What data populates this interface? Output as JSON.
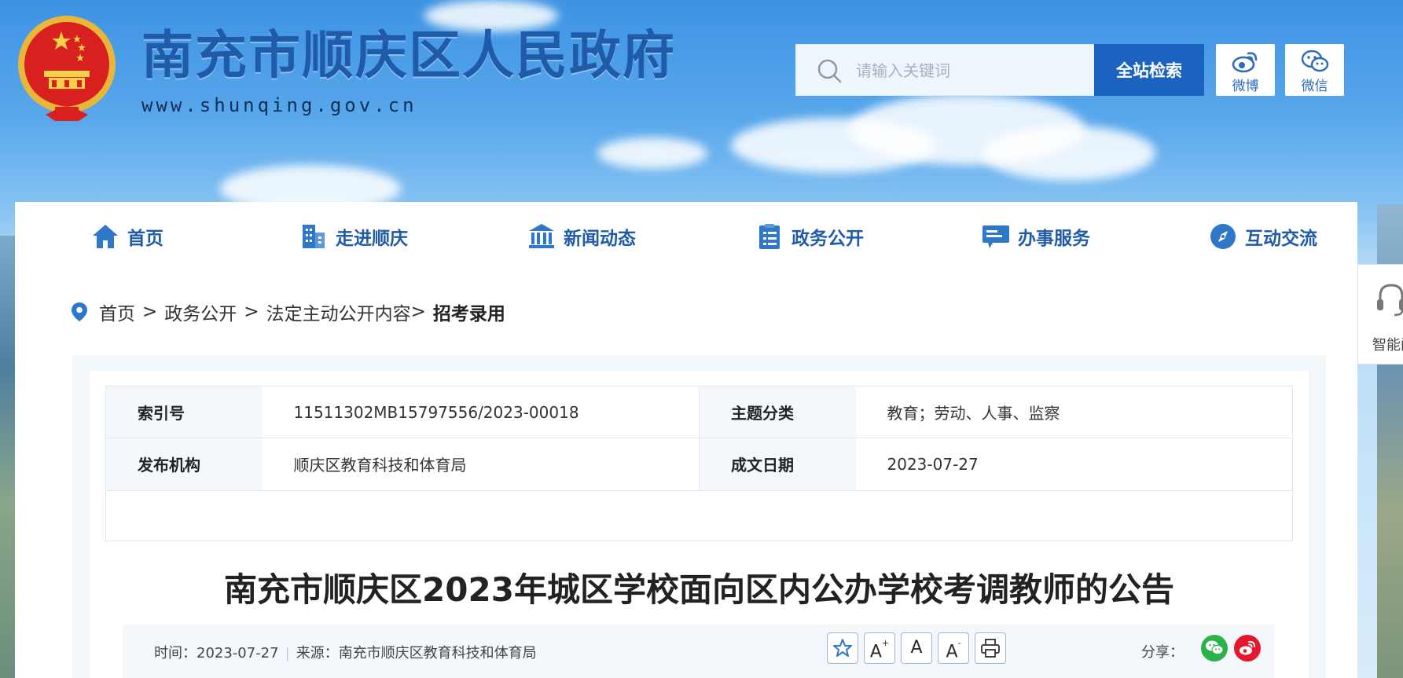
{
  "header": {
    "site_title": "南充市顺庆区人民政府",
    "site_url": "www.shunqing.gov.cn",
    "search": {
      "placeholder": "请输入关键词",
      "value": "",
      "button_label": "全站检索"
    },
    "social": [
      {
        "label": "微博",
        "icon": "weibo-icon"
      },
      {
        "label": "微信",
        "icon": "wechat-icon"
      }
    ]
  },
  "nav": {
    "items": [
      {
        "label": "首页",
        "icon": "home-icon"
      },
      {
        "label": "走进顺庆",
        "icon": "building-icon"
      },
      {
        "label": "新闻动态",
        "icon": "bank-icon"
      },
      {
        "label": "政务公开",
        "icon": "clipboard-list-icon"
      },
      {
        "label": "办事服务",
        "icon": "service-window-icon"
      },
      {
        "label": "互动交流",
        "icon": "compass-icon"
      }
    ]
  },
  "breadcrumb": {
    "icon": "location-pin-icon",
    "items": [
      "首页",
      "政务公开",
      "法定主动公开内容"
    ],
    "separator": ">",
    "current": "招考录用"
  },
  "meta": {
    "index_no_label": "索引号",
    "index_no": "11511302MB15797556/2023-00018",
    "topic_label": "主题分类",
    "topic": "教育；劳动、人事、监察",
    "publisher_label": "发布机构",
    "publisher": "顺庆区教育科技和体育局",
    "date_label": "成文日期",
    "date": "2023-07-27"
  },
  "article": {
    "title": "南充市顺庆区2023年城区学校面向区内公办学校考调教师的公告",
    "time_label": "时间：",
    "time": "2023-07-27",
    "source_label": "来源：",
    "source": "南充市顺庆区教育科技和体育局",
    "tools": [
      {
        "name": "favorite-button",
        "icon": "star-icon"
      },
      {
        "name": "font-increase-button",
        "label": "A",
        "sup": "+"
      },
      {
        "name": "font-default-button",
        "label": "A"
      },
      {
        "name": "font-decrease-button",
        "label": "A",
        "sup": "-"
      },
      {
        "name": "print-button",
        "icon": "printer-icon"
      }
    ],
    "share_label": "分享：",
    "share": [
      {
        "name": "share-wechat",
        "icon": "wechat-icon",
        "color": "#2bb24c"
      },
      {
        "name": "share-weibo",
        "icon": "weibo-icon",
        "color": "#e6162d"
      }
    ]
  },
  "side_widget": {
    "label": "智能问",
    "icon": "headset-icon"
  },
  "colors": {
    "brand_blue": "#1f5ba8",
    "button_blue": "#1c63c1",
    "panel_bg": "#f3f8fd"
  }
}
